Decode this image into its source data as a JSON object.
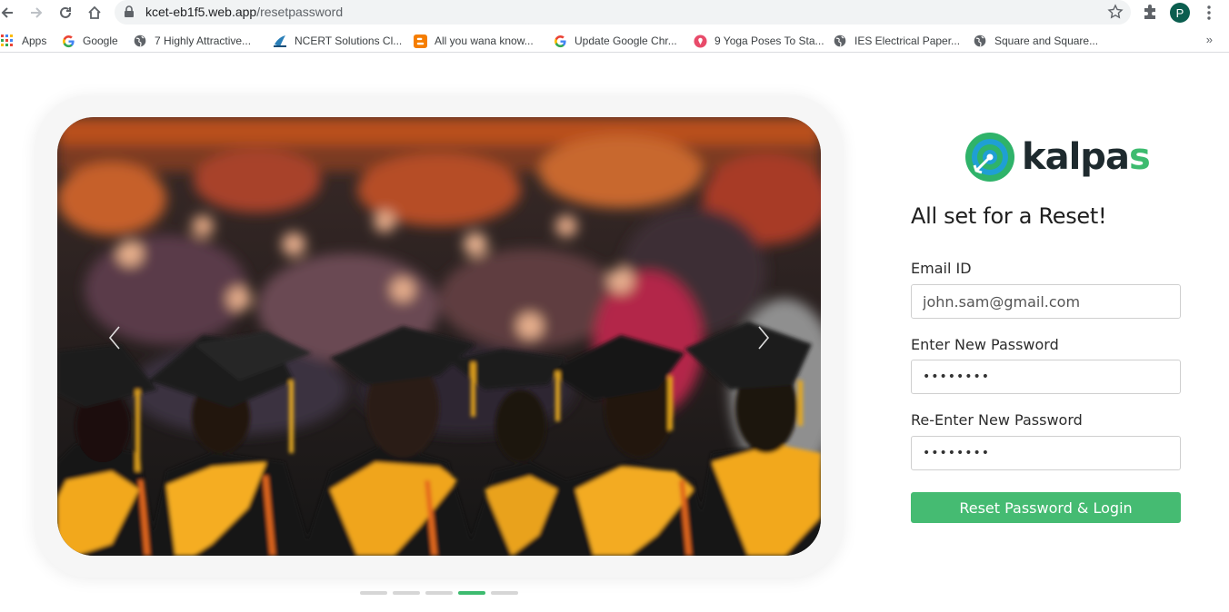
{
  "browser": {
    "url_host": "kcet-eb1f5.web.app",
    "url_path": "/resetpassword",
    "profile_initial": "P",
    "bookmarks": [
      {
        "label": "Apps",
        "icon": "apps-grid-icon"
      },
      {
        "label": "Google",
        "icon": "google-g-icon"
      },
      {
        "label": "7 Highly Attractive...",
        "icon": "globe-icon"
      },
      {
        "label": "NCERT Solutions Cl...",
        "icon": "ncert-icon"
      },
      {
        "label": "All you wana know...",
        "icon": "blogger-icon"
      },
      {
        "label": "Update Google Chr...",
        "icon": "google-g-icon"
      },
      {
        "label": "9 Yoga Poses To Sta...",
        "icon": "yoga-icon"
      },
      {
        "label": "IES Electrical Paper...",
        "icon": "globe-icon"
      },
      {
        "label": "Square and Square...",
        "icon": "globe-icon"
      }
    ],
    "overflow_label": "»"
  },
  "carousel": {
    "slide_count": 5,
    "active_index": 3
  },
  "brand": {
    "name_main": "kalpa",
    "name_accent": "s",
    "accent_color": "#3dbb6f"
  },
  "form": {
    "title": "All set for a Reset!",
    "email_label": "Email ID",
    "email_value": "john.sam@gmail.com",
    "new_password_label": "Enter New Password",
    "new_password_value": "••••••••",
    "reenter_password_label": "Re-Enter New Password",
    "reenter_password_value": "••••••••",
    "submit_label": "Reset Password & Login"
  }
}
